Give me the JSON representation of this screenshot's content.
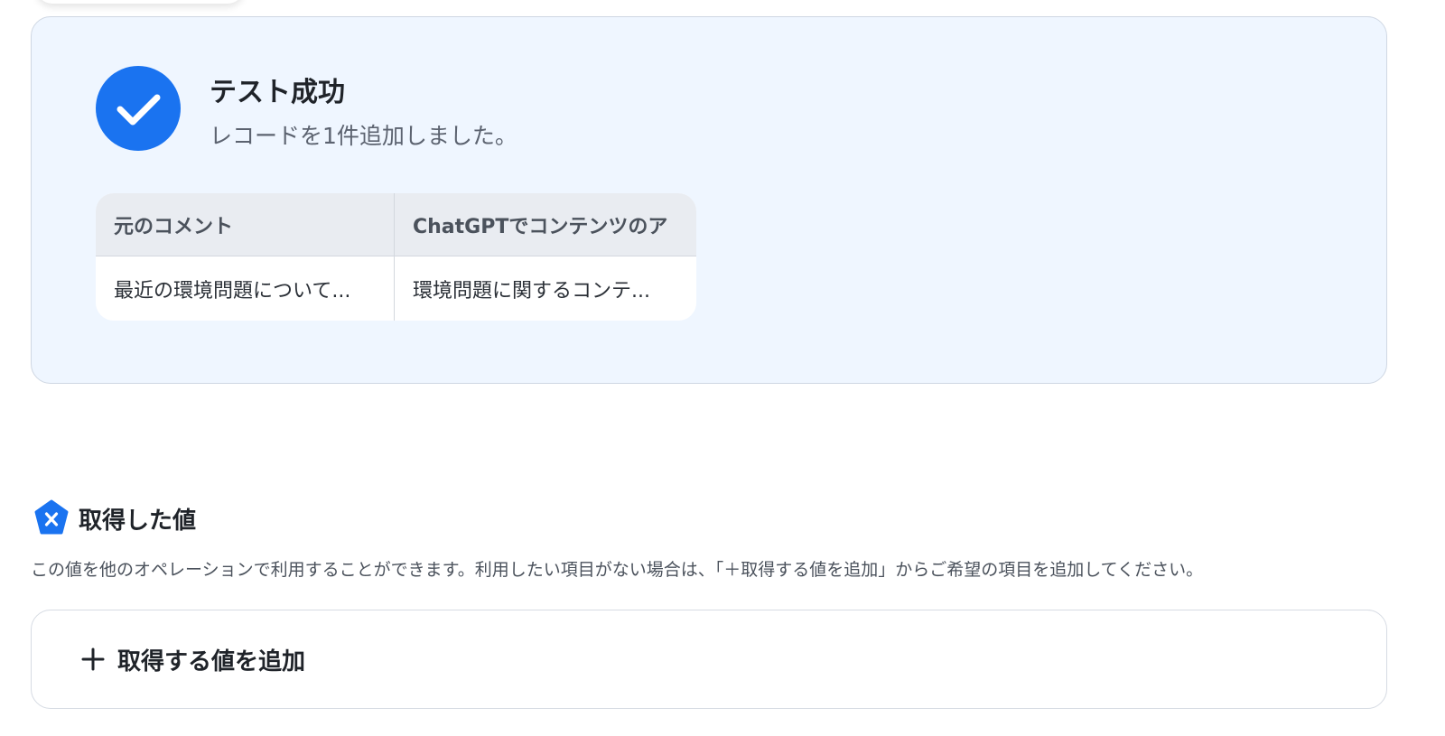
{
  "colors": {
    "accent": "#1a73f0",
    "panel_background": "#eff6ff",
    "table_header_background": "#e9ecf1"
  },
  "result": {
    "icon": "check-circle-icon",
    "title": "テスト成功",
    "message": "レコードを1件追加しました。"
  },
  "record_table": {
    "columns": [
      "元のコメント",
      "ChatGPTでコンテンツのア"
    ],
    "rows": [
      [
        "最近の環境問題について...",
        "環境問題に関するコンテ..."
      ]
    ]
  },
  "values_section": {
    "icon": "variable-x-icon",
    "title": "取得した値",
    "description": "この値を他のオペレーションで利用することができます。利用したい項目がない場合は、「＋取得する値を追加」からご希望の項目を追加してください。"
  },
  "add_value_button": {
    "icon": "plus-icon",
    "label": "取得する値を追加"
  }
}
